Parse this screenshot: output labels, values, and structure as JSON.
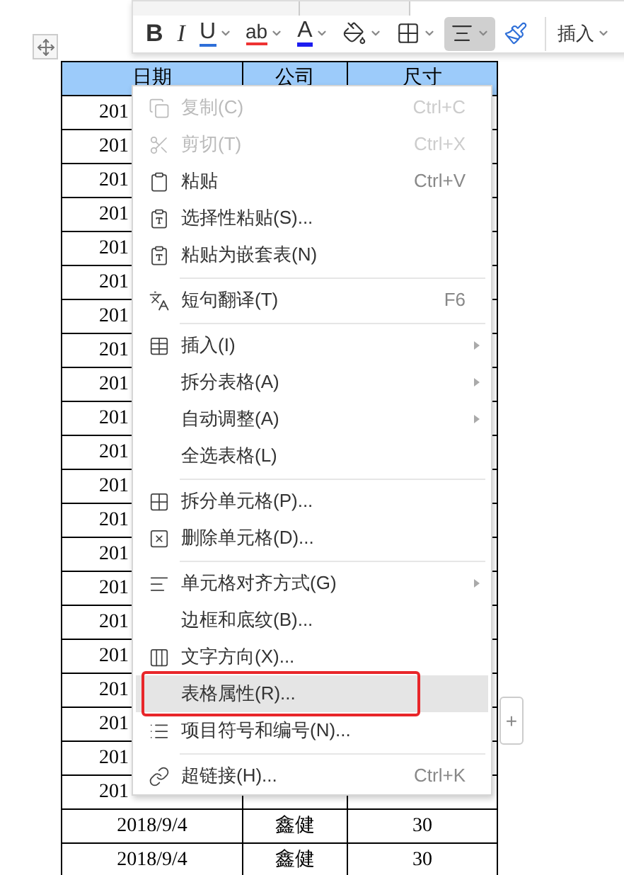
{
  "toolbar": {
    "buttons": [
      {
        "kind": "bold",
        "label": "B",
        "dropdown": false,
        "selected": false
      },
      {
        "kind": "italic",
        "label": "I",
        "dropdown": false,
        "selected": false
      },
      {
        "kind": "underline",
        "label": "U",
        "dropdown": true,
        "selected": false
      },
      {
        "kind": "highlight",
        "label": "ab",
        "dropdown": true,
        "selected": false
      },
      {
        "kind": "font-color",
        "label": "A",
        "dropdown": true,
        "selected": false
      },
      {
        "kind": "fill",
        "dropdown": true,
        "selected": false
      },
      {
        "kind": "borders",
        "dropdown": true,
        "selected": false
      },
      {
        "kind": "align",
        "dropdown": true,
        "selected": true
      },
      {
        "kind": "painter",
        "dropdown": false,
        "selected": false
      }
    ],
    "insert_button": "插入"
  },
  "table": {
    "columns": [
      "日期",
      "公司",
      "尺寸"
    ],
    "rows": [
      [
        "201"
      ],
      [
        "201"
      ],
      [
        "201"
      ],
      [
        "201"
      ],
      [
        "201"
      ],
      [
        "201"
      ],
      [
        "201"
      ],
      [
        "201"
      ],
      [
        "201"
      ],
      [
        "201"
      ],
      [
        "201"
      ],
      [
        "201"
      ],
      [
        "201"
      ],
      [
        "201"
      ],
      [
        "201"
      ],
      [
        "201"
      ],
      [
        "201"
      ],
      [
        "201"
      ],
      [
        "201"
      ],
      [
        "201"
      ],
      [
        "201"
      ],
      [
        "2018/9/4",
        "鑫健",
        "30"
      ],
      [
        "2018/9/4",
        "鑫健",
        "30"
      ]
    ],
    "add_button": "+"
  },
  "context_menu": [
    {
      "kind": "item",
      "label": "复制(C)",
      "shortcut": "Ctrl+C",
      "disabled": true,
      "submenu": false,
      "selected": false,
      "annotated": false
    },
    {
      "kind": "item",
      "label": "剪切(T)",
      "shortcut": "Ctrl+X",
      "disabled": true,
      "submenu": false,
      "selected": false,
      "annotated": false
    },
    {
      "kind": "item",
      "label": "粘贴",
      "shortcut": "Ctrl+V",
      "disabled": false,
      "submenu": false,
      "selected": false,
      "annotated": false
    },
    {
      "kind": "item",
      "label": "选择性粘贴(S)...",
      "disabled": false,
      "submenu": false,
      "selected": false,
      "annotated": false
    },
    {
      "kind": "item",
      "label": "粘贴为嵌套表(N)",
      "disabled": false,
      "submenu": false,
      "selected": false,
      "annotated": false
    },
    {
      "kind": "separator"
    },
    {
      "kind": "item",
      "label": "短句翻译(T)",
      "shortcut": "F6",
      "disabled": false,
      "submenu": false,
      "selected": false,
      "annotated": false
    },
    {
      "kind": "separator"
    },
    {
      "kind": "item",
      "label": "插入(I)",
      "disabled": false,
      "submenu": true,
      "selected": false,
      "annotated": false
    },
    {
      "kind": "item",
      "label": "拆分表格(A)",
      "disabled": false,
      "submenu": true,
      "selected": false,
      "annotated": false
    },
    {
      "kind": "item",
      "label": "自动调整(A)",
      "disabled": false,
      "submenu": true,
      "selected": false,
      "annotated": false
    },
    {
      "kind": "item",
      "label": "全选表格(L)",
      "disabled": false,
      "submenu": false,
      "selected": false,
      "annotated": false
    },
    {
      "kind": "separator"
    },
    {
      "kind": "item",
      "label": "拆分单元格(P)...",
      "disabled": false,
      "submenu": false,
      "selected": false,
      "annotated": false
    },
    {
      "kind": "item",
      "label": "删除单元格(D)...",
      "disabled": false,
      "submenu": false,
      "selected": false,
      "annotated": false
    },
    {
      "kind": "separator"
    },
    {
      "kind": "item",
      "label": "单元格对齐方式(G)",
      "disabled": false,
      "submenu": true,
      "selected": false,
      "annotated": false
    },
    {
      "kind": "item",
      "label": "边框和底纹(B)...",
      "disabled": false,
      "submenu": false,
      "selected": false,
      "annotated": false
    },
    {
      "kind": "item",
      "label": "文字方向(X)...",
      "disabled": false,
      "submenu": false,
      "selected": false,
      "annotated": false
    },
    {
      "kind": "item",
      "label": "表格属性(R)...",
      "disabled": false,
      "submenu": false,
      "selected": true,
      "annotated": true
    },
    {
      "kind": "item",
      "label": "项目符号和编号(N)...",
      "disabled": false,
      "submenu": false,
      "selected": false,
      "annotated": false
    },
    {
      "kind": "separator"
    },
    {
      "kind": "item",
      "label": "超链接(H)...",
      "shortcut": "Ctrl+K",
      "disabled": false,
      "submenu": false,
      "selected": false,
      "annotated": false
    }
  ]
}
